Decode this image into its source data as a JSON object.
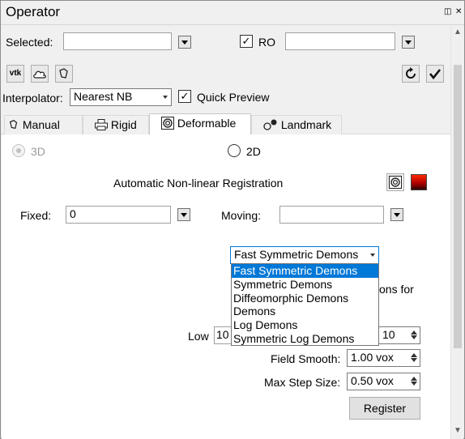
{
  "window": {
    "title": "Operator",
    "float_glyph": "◫",
    "close_glyph": "✕"
  },
  "selection": {
    "selected_label": "Selected:",
    "selected_value": "",
    "ro_checked": true,
    "ro_label": "RO",
    "ro_value": ""
  },
  "toolbar": {
    "vtk_label": "vtk",
    "icons": [
      "vtk-icon",
      "cloud-icon",
      "manual-transform-icon",
      "refresh-icon",
      "check-icon"
    ]
  },
  "interp": {
    "label": "Interpolator:",
    "value": "Nearest NB",
    "quick_preview_label": "Quick Preview",
    "quick_preview_checked": true
  },
  "tabs": [
    {
      "label": "Manual",
      "icon": "manual-icon"
    },
    {
      "label": "Rigid",
      "icon": "printer-icon"
    },
    {
      "label": "Deformable",
      "icon": "deformable-icon",
      "active": true
    },
    {
      "label": "Landmark",
      "icon": "landmark-icon"
    }
  ],
  "deformable": {
    "radio_3d": "3D",
    "radio_2d": "2D",
    "heading": "Automatic Non-linear Registration",
    "fixed_label": "Fixed:",
    "fixed_value": "0",
    "moving_label": "Moving:",
    "moving_value": "",
    "algorithm_selected": "Fast Symmetric Demons",
    "algorithm_options": [
      "Fast Symmetric Demons",
      "Symmetric Demons",
      "Diffeomorphic Demons",
      "Demons",
      "Log Demons",
      "Symmetric Log Demons"
    ],
    "hidden_text_fragment": "ons for",
    "low_label": "Low",
    "low_value_fragment": "10",
    "high_value_fragment": "10",
    "field_smooth_label": "Field Smooth:",
    "field_smooth_value": "1.00 vox",
    "max_step_label": "Max Step Size:",
    "max_step_value": "0.50 vox",
    "register_label": "Register"
  }
}
